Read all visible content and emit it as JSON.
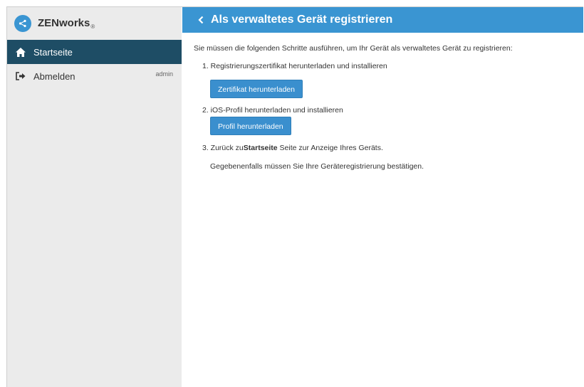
{
  "sidebar": {
    "brand": "ZENworks",
    "brand_mark": "®",
    "items": [
      {
        "label": "Startseite"
      },
      {
        "label": "Abmelden",
        "user": "admin"
      }
    ]
  },
  "header": {
    "title": "Als verwaltetes Gerät registrieren"
  },
  "main": {
    "intro": "Sie müssen die folgenden Schritte ausführen, um Ihr Gerät als verwaltetes Gerät zu registrieren:",
    "step1": "1. Registrierungszertifikat herunterladen und installieren",
    "step1_button": "Zertifikat herunterladen",
    "step2": "2. iOS-Profil herunterladen und installieren",
    "step2_button": "Profil herunterladen",
    "step3_prefix": "3. Zurück zu",
    "step3_bold": "Startseite",
    "step3_suffix": " Seite zur Anzeige Ihres Geräts.",
    "note": "Gegebenenfalls müssen Sie Ihre Geräteregistrierung bestätigen."
  },
  "colors": {
    "accent": "#3a95d2",
    "nav_active": "#1e4d65",
    "sidebar_bg": "#ebebeb"
  },
  "icons": [
    "zenworks-logo-icon",
    "chevron-left-icon",
    "home-icon",
    "sign-out-icon"
  ]
}
